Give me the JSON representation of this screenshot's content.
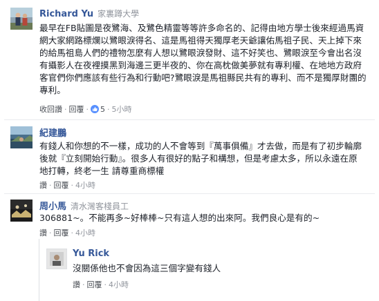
{
  "comments": [
    {
      "author": "Richard Yu",
      "workplace": "家裏蹲大學",
      "lines": [
        "最早在FB貼圖是夜鷺海、及鷺色精靈等等許多命名的、記得由地方學士後來經過馬資",
        "網大家網路標爛以鷺眼淚得名、這是馬祖得天獨厚老天爺讓佑馬祖子民、天上掉下來",
        "的給馬祖島人們的禮物怎麼有人想以鷺眼淚發財、這不好笑也、鷺眼淚至今會出名沒",
        "有攝影人在夜裡摸黑到海邊三更半夜的、你在高枕做美夢就有專利權、在地地方政府",
        "客官們你們應該有些行為和行動吧?鷺眼淚是馬祖縣民共有的專利、而不是獨厚財團的",
        "專利。"
      ],
      "actions": {
        "reply": "收回讚",
        "reply2": "回覆",
        "likes": "5",
        "time": "5小時"
      }
    },
    {
      "author": "紀建鵬",
      "workplace": "",
      "lines": [
        "有錢人和你想的不一樣，成功的人不會等到『萬事俱備』才去做，而是有了初步輪廓",
        "後就『立刻開始行動』。很多人有很好的點子和構想，但是考慮太多，所以永遠在原",
        "地打轉，終老一生 請尊重商標權"
      ],
      "actions": {
        "reply": "讚",
        "reply2": "回覆",
        "time": "4小時"
      }
    },
    {
      "author": "周小馬",
      "workplace": "清水灣客棧員工",
      "lines": [
        "306881~。不能再多~好棒棒~只有這人想的出來阿。我們良心是有的~"
      ],
      "actions": {
        "reply": "讚",
        "reply2": "回覆",
        "time": "4小時"
      }
    },
    {
      "author": "Yu Rick",
      "workplace": "",
      "lines": [
        "沒關係他也不會因為這三個字變有錢人"
      ],
      "actions": {
        "reply": "讚",
        "reply2": "回覆",
        "time": "4小時"
      }
    }
  ],
  "colors": {
    "link": "#365899",
    "meta": "#90949c",
    "like": "#5890ff"
  },
  "icons": {
    "like": "thumbs-up-icon"
  }
}
